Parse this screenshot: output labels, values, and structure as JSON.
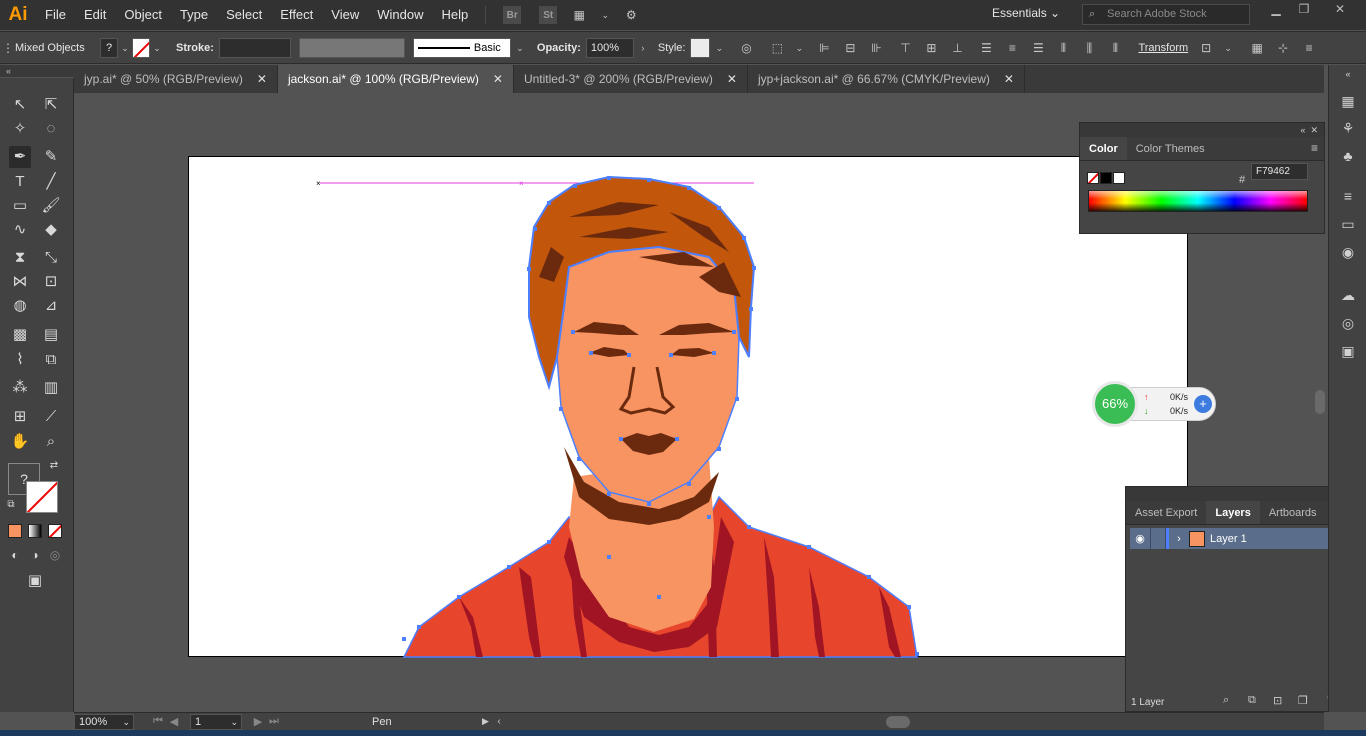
{
  "app": {
    "logo": "Ai"
  },
  "menu": [
    "File",
    "Edit",
    "Object",
    "Type",
    "Select",
    "Effect",
    "View",
    "Window",
    "Help"
  ],
  "app_icons": [
    "Br",
    "St"
  ],
  "workspace": {
    "label": "Essentials"
  },
  "search": {
    "placeholder": "Search Adobe Stock"
  },
  "control_bar": {
    "selection_label": "Mixed Objects",
    "stroke_label": "Stroke:",
    "brush_label": "Basic",
    "opacity_label": "Opacity:",
    "opacity_value": "100%",
    "style_label": "Style:",
    "transform_label": "Transform"
  },
  "tabs": [
    {
      "label": "jyp.ai* @ 50% (RGB/Preview)",
      "close": "✕"
    },
    {
      "label": "jackson.ai* @ 100% (RGB/Preview)",
      "close": "✕"
    },
    {
      "label": "Untitled-3* @ 200% (RGB/Preview)",
      "close": "✕"
    },
    {
      "label": "jyp+jackson.ai* @ 66.67% (CMYK/Preview)",
      "close": "✕"
    }
  ],
  "color_panel": {
    "tabs": [
      "Color",
      "Color Themes"
    ],
    "hex_symbol": "#",
    "hex_value": "F79462"
  },
  "layers_panel": {
    "tabs": [
      "Asset Export",
      "Layers",
      "Artboards"
    ],
    "layer_name": "Layer 1",
    "footer_count": "1 Layer"
  },
  "speed_widget": {
    "percent": "66%",
    "up": "0K/s",
    "down": "0K/s"
  },
  "status_bar": {
    "zoom": "100%",
    "artboard_number": "1",
    "current_tool": "Pen"
  },
  "colors": {
    "accent": "#ff9a00",
    "hair": "#c2570c",
    "hair_dark": "#6b2a0e",
    "skin": "#f79462",
    "shirt": "#e8462c",
    "shirt_dark": "#a11424",
    "anchor": "#4d7fff",
    "guide": "#e43ce0"
  }
}
